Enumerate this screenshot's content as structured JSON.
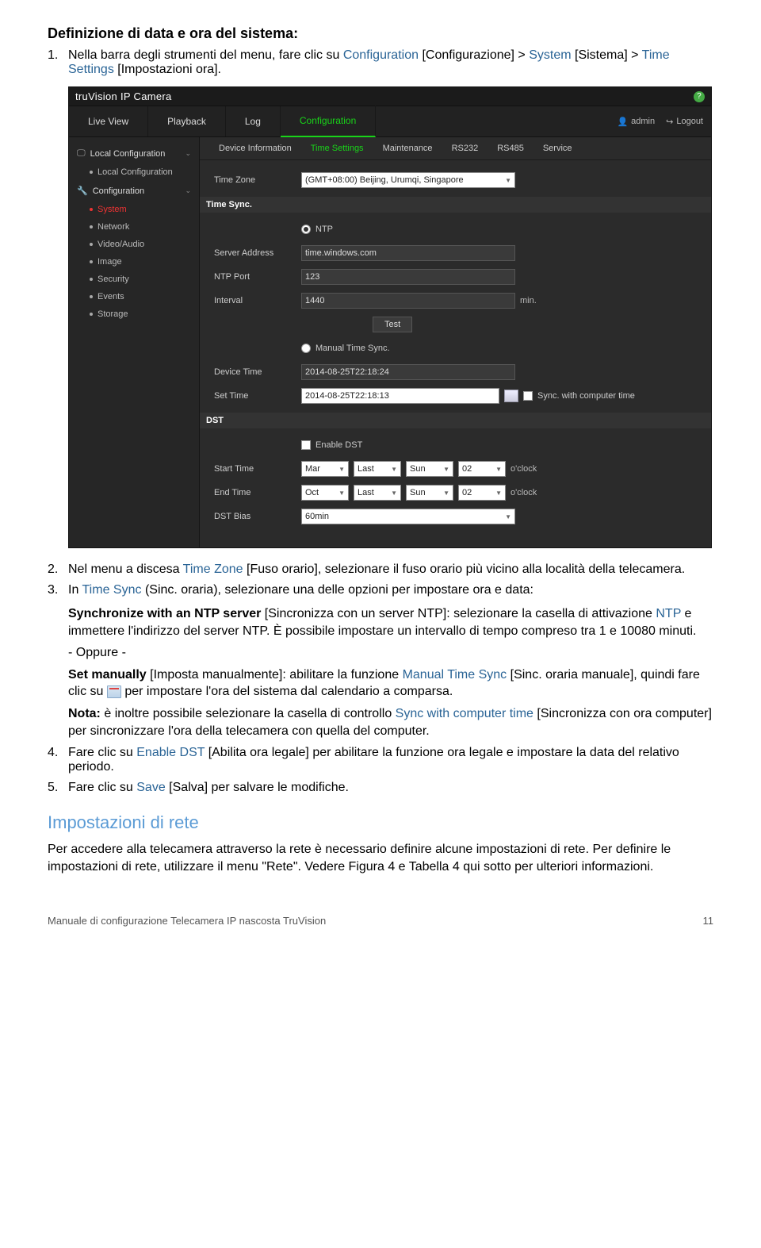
{
  "doc": {
    "heading": "Definizione di data e ora del sistema:",
    "step1_pre": "Nella barra degli strumenti del menu, fare clic su ",
    "step1_conf": "Configuration",
    "step1_conf_br": " [Configurazione] > ",
    "step1_sys": "System",
    "step1_sys_br": " [Sistema] > ",
    "step1_ts": "Time Settings",
    "step1_ts_br": " [Impostazioni ora].",
    "step2_pre": "Nel menu a discesa ",
    "step2_tz": "Time Zone",
    "step2_post": " [Fuso orario], selezionare il fuso orario più vicino alla località della telecamera.",
    "step3_pre": "In ",
    "step3_ts": "Time Sync",
    "step3_post": " (Sinc. oraria), selezionare una delle opzioni per impostare ora e data:",
    "sync_ntp_label": "Synchronize with an NTP server",
    "sync_ntp_text1": " [Sincronizza con un server NTP]: selezionare la casella di attivazione ",
    "ntp_word": "NTP",
    "sync_ntp_text2": " e immettere l'indirizzo del server NTP. È possibile impostare un intervallo di tempo compreso tra 1 e 10080 minuti.",
    "oppure": "- Oppure -",
    "set_man_label": "Set manually",
    "set_man_text1": " [Imposta manualmente]: abilitare la funzione ",
    "man_ts": "Manual Time Sync",
    "set_man_text2": " [Sinc. oraria manuale], quindi fare clic su ",
    "set_man_text3": " per impostare l'ora del sistema dal calendario a comparsa.",
    "nota_label": "Nota:",
    "nota_text1": " è inoltre possibile selezionare la casella di controllo ",
    "sync_comp": "Sync with computer time",
    "nota_text2": " [Sincronizza con ora computer] per sincronizzare l'ora della telecamera con quella del computer.",
    "step4_pre": "Fare clic su ",
    "step4_dst": "Enable DST",
    "step4_post": " [Abilita ora legale] per abilitare la funzione ora legale e impostare la data del relativo periodo.",
    "step5_pre": "Fare clic su ",
    "step5_save": "Save",
    "step5_post": " [Salva] per salvare le modifiche.",
    "section_net": "Impostazioni di rete",
    "net_para": "Per accedere alla telecamera attraverso la rete è necessario definire alcune impostazioni di rete. Per definire le impostazioni di rete, utilizzare il menu \"Rete\". Vedere Figura 4 e Tabella 4 qui sotto per ulteriori informazioni.",
    "footer_left": "Manuale di configurazione Telecamera IP nascosta TruVision",
    "footer_right": "11"
  },
  "app": {
    "brand": "truVision  IP Camera",
    "topnav": [
      "Live View",
      "Playback",
      "Log",
      "Configuration"
    ],
    "user": "admin",
    "logout": "Logout",
    "sidebar": {
      "group1": "Local Configuration",
      "group1_items": [
        "Local Configuration"
      ],
      "group2": "Configuration",
      "group2_items": [
        "System",
        "Network",
        "Video/Audio",
        "Image",
        "Security",
        "Events",
        "Storage"
      ]
    },
    "subtabs": [
      "Device Information",
      "Time Settings",
      "Maintenance",
      "RS232",
      "RS485",
      "Service"
    ],
    "tz_label": "Time Zone",
    "tz_value": "(GMT+08:00) Beijing, Urumqi, Singapore",
    "timesync": "Time Sync.",
    "ntp": "NTP",
    "server_addr_label": "Server Address",
    "server_addr_value": "time.windows.com",
    "ntp_port_label": "NTP Port",
    "ntp_port_value": "123",
    "interval_label": "Interval",
    "interval_value": "1440",
    "interval_unit": "min.",
    "test": "Test",
    "manual": "Manual Time Sync.",
    "device_time_label": "Device Time",
    "device_time_value": "2014-08-25T22:18:24",
    "set_time_label": "Set Time",
    "set_time_value": "2014-08-25T22:18:13",
    "sync_comp_label": "Sync. with computer time",
    "dst": "DST",
    "enable_dst": "Enable DST",
    "start_label": "Start Time",
    "end_label": "End Time",
    "start_vals": [
      "Mar",
      "Last",
      "Sun",
      "02"
    ],
    "end_vals": [
      "Oct",
      "Last",
      "Sun",
      "02"
    ],
    "oclock": "o'clock",
    "bias_label": "DST Bias",
    "bias_value": "60min"
  }
}
